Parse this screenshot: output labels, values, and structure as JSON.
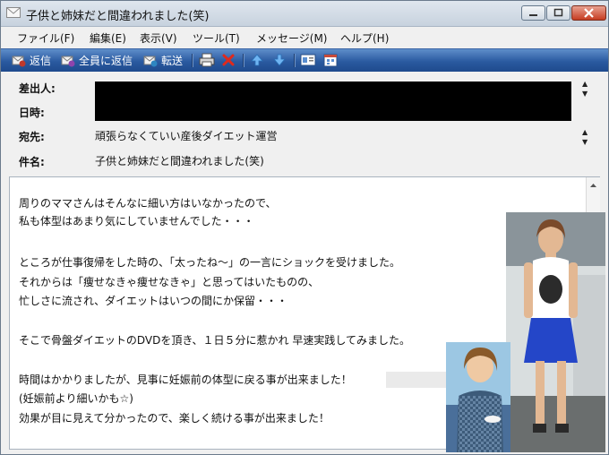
{
  "window": {
    "title": "子供と姉妹だと間違われました(笑)"
  },
  "menu": {
    "items": [
      "ファイル(F)",
      "編集(E)",
      "表示(V)",
      "ツール(T)",
      "メッセージ(M)",
      "ヘルプ(H)"
    ]
  },
  "toolbar": {
    "reply": "返信",
    "reply_all": "全員に返信",
    "forward": "転送"
  },
  "header": {
    "from_label": "差出人:",
    "date_label": "日時:",
    "to_label": "宛先:",
    "to_value": "頑張らなくていい産後ダイエット運営",
    "subject_label": "件名:",
    "subject_value": "子供と姉妹だと間違われました(笑)"
  },
  "body": {
    "lines": [
      "周りのママさんはそんなに細い方はいなかったので、",
      "私も体型はあまり気にしていませんでした・・・",
      "ところが仕事復帰をした時の、「太ったね～」の一言にショックを受けました。",
      "それからは「痩せなきゃ痩せなきゃ」と思ってはいたものの、",
      "忙しさに流され、ダイエットはいつの間にか保留・・・",
      "そこで骨盤ダイエットのDVDを頂き、１日５分に惹かれ 早速実践してみました。",
      "時間はかかりましたが、見事に妊娠前の体型に戻る事が出来ました！",
      "(妊娠前より細いかも☆)",
      "効果が目に見えて分かったので、楽しく続ける事が出来ました！"
    ]
  },
  "icons": {
    "title": "envelope-icon",
    "reply": "reply-icon",
    "reply_all": "reply-all-icon",
    "forward": "forward-icon",
    "print": "printer-icon",
    "delete": "delete-x-icon",
    "prev": "arrow-up-icon",
    "next": "arrow-down-icon",
    "addresses": "address-book-icon",
    "calendar": "calendar-icon"
  }
}
